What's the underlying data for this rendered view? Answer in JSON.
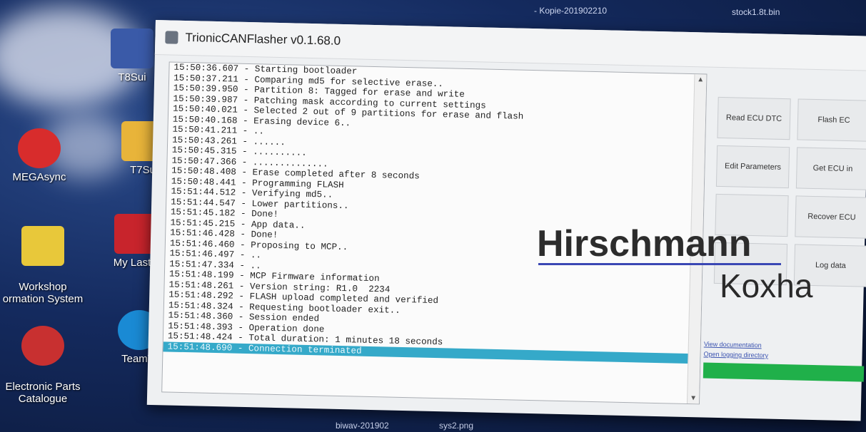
{
  "desktop": {
    "top_files": [
      "- Kopie-201902210",
      "stock1.8t.bin"
    ],
    "icons": [
      {
        "label": "T8Sui"
      },
      {
        "label": "MEGAsync"
      },
      {
        "label": "T7Su"
      },
      {
        "label": "Workshop\normation System"
      },
      {
        "label": "My LastP"
      },
      {
        "label": "Electronic Parts\nCatalogue"
      },
      {
        "label": "TeamVi"
      }
    ],
    "bottom_files": [
      "biwav-201902",
      "sys2.png"
    ]
  },
  "window": {
    "title": "TrionicCANFlasher v0.1.68.0",
    "log": [
      "15:50:36.607 - Starting bootloader",
      "15:50:37.211 - Comparing md5 for selective erase..",
      "15:50:39.950 - Partition 8: Tagged for erase and write",
      "15:50:39.987 - Patching mask according to current settings",
      "15:50:40.021 - Selected 2 out of 9 partitions for erase and flash",
      "15:50:40.168 - Erasing device 6..",
      "15:50:41.211 - ..",
      "15:50:43.261 - ......",
      "15:50:45.315 - ..........",
      "15:50:47.366 - ..............",
      "15:50:48.408 - Erase completed after 8 seconds",
      "15:50:48.441 - Programming FLASH",
      "15:51:44.512 - Verifying md5..",
      "15:51:44.547 - Lower partitions..",
      "15:51:45.182 - Done!",
      "15:51:45.215 - App data..",
      "15:51:46.428 - Done!",
      "15:51:46.460 - Proposing to MCP..",
      "15:51:46.497 - ..",
      "15:51:47.334 - ..",
      "15:51:48.199 - MCP Firmware information",
      "15:51:48.261 - Version string: R1.0  2234",
      "15:51:48.292 - FLASH upload completed and verified",
      "15:51:48.324 - Requesting bootloader exit..",
      "15:51:48.360 - Session ended",
      "15:51:48.393 - Operation done",
      "15:51:48.424 - Total duration: 1 minutes 18 seconds",
      "15:51:48.690 - Connection terminated"
    ],
    "buttons": [
      "Read ECU DTC",
      "Flash EC",
      "Edit Parameters",
      "Get ECU in",
      "Recover ECU",
      "Log data"
    ],
    "links": [
      "View documentation",
      "Open logging directory"
    ],
    "progress_fraction": 1.0,
    "accent_color": "#35a9c9",
    "progress_color": "#20b04a"
  },
  "watermark": {
    "brand": "Hirschmann",
    "name": "Koxha"
  }
}
